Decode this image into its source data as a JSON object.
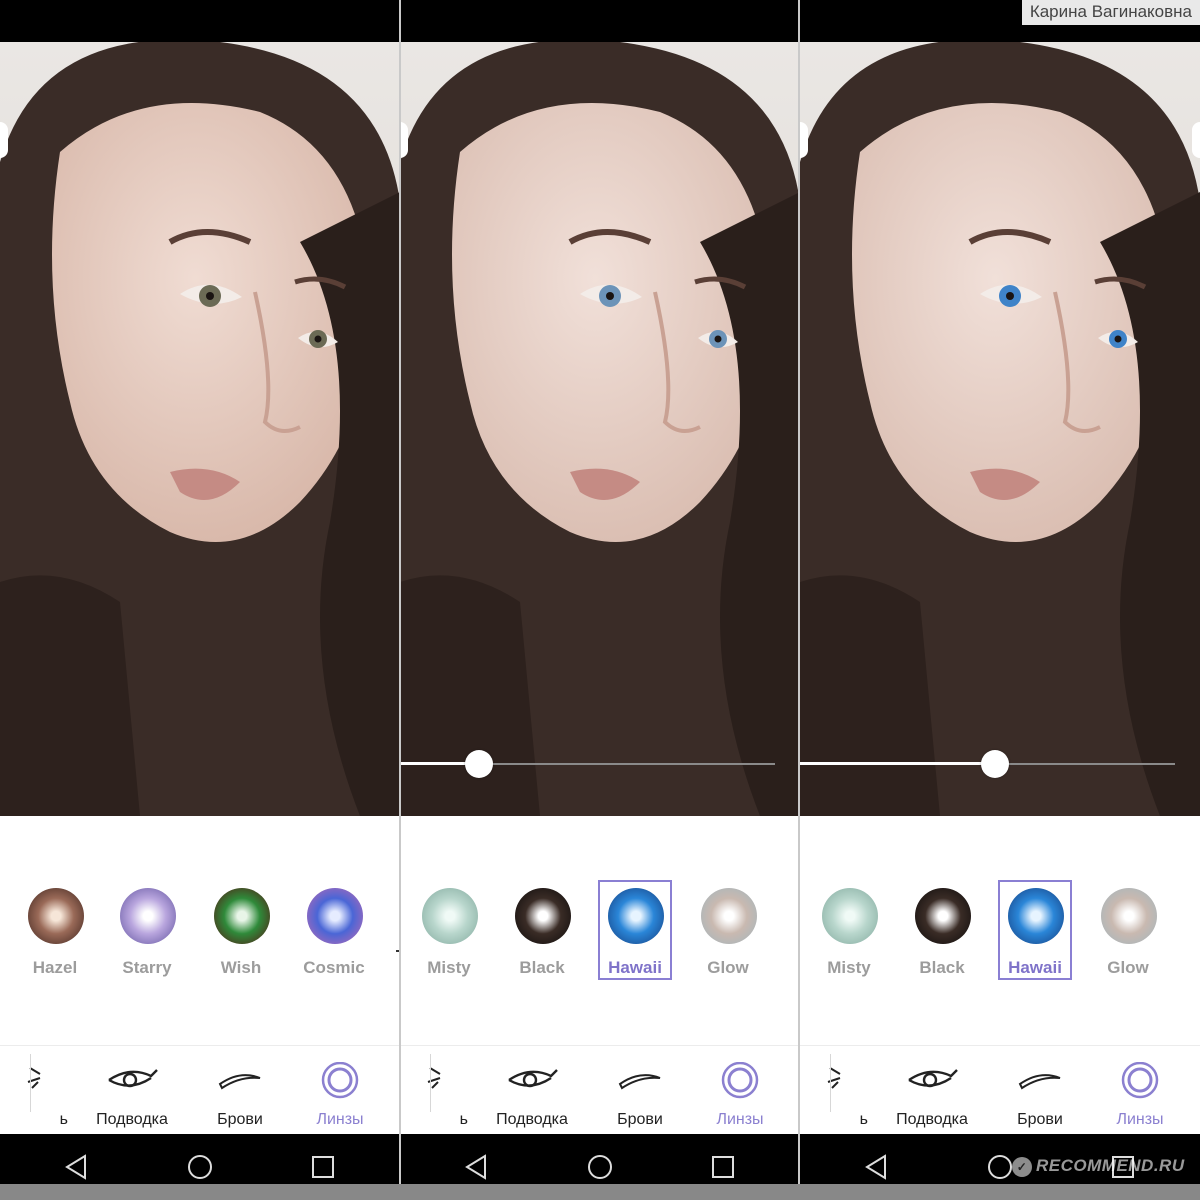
{
  "credit": {
    "author_name": "Карина Вагинаковна",
    "watermark": "RECOMMEND.RU"
  },
  "colors": {
    "accent": "#8b80d0",
    "selected_border": "#8a7fd3",
    "label_gray": "#9c9c9c"
  },
  "panels": [
    {
      "state": "original",
      "slider": null,
      "lenses": [
        {
          "name": "Hazel",
          "selected": false,
          "inner": "#f6e6d8",
          "mid": "#9a6a58",
          "outer": "#3a211b"
        },
        {
          "name": "Starry",
          "selected": false,
          "inner": "#ffffff",
          "mid": "#b9a6de",
          "outer": "#5c4f9c"
        },
        {
          "name": "Wish",
          "selected": false,
          "inner": "#e8f5e8",
          "mid": "#2f8a3a",
          "outer": "#5a0f10"
        },
        {
          "name": "Cosmic",
          "selected": false,
          "inner": "#e6ecff",
          "mid": "#4a66d6",
          "outer": "#c46ab0"
        }
      ],
      "tools": {
        "partial_label": "ь",
        "items": [
          "Подводка",
          "Брови",
          "Линзы"
        ],
        "active_index": 2
      }
    },
    {
      "state": "hawaii-low",
      "slider": {
        "value": 0.21
      },
      "lenses": [
        {
          "name": "Misty",
          "selected": false,
          "inner": "#f0faf6",
          "mid": "#b8d6cc",
          "outer": "#7fa79b"
        },
        {
          "name": "Black",
          "selected": false,
          "inner": "#ffffff",
          "mid": "#3a2c26",
          "outer": "#0c0a0a"
        },
        {
          "name": "Hawaii",
          "selected": true,
          "inner": "#e7f4ff",
          "mid": "#2a86d8",
          "outer": "#153a7a"
        },
        {
          "name": "Glow",
          "selected": false,
          "inner": "#ffffff",
          "mid": "#c9b9b0",
          "outer": "#9fb5bf"
        }
      ],
      "tools": {
        "partial_label": "ь",
        "items": [
          "Подводка",
          "Брови",
          "Линзы"
        ],
        "active_index": 2
      }
    },
    {
      "state": "hawaii-high",
      "slider": {
        "value": 0.52
      },
      "lenses": [
        {
          "name": "Misty",
          "selected": false,
          "inner": "#f0faf6",
          "mid": "#b8d6cc",
          "outer": "#7fa79b"
        },
        {
          "name": "Black",
          "selected": false,
          "inner": "#ffffff",
          "mid": "#3a2c26",
          "outer": "#0c0a0a"
        },
        {
          "name": "Hawaii",
          "selected": true,
          "inner": "#e7f4ff",
          "mid": "#2a86d8",
          "outer": "#153a7a"
        },
        {
          "name": "Glow",
          "selected": false,
          "inner": "#ffffff",
          "mid": "#c9b9b0",
          "outer": "#9fb5bf"
        }
      ],
      "tools": {
        "partial_label": "ь",
        "items": [
          "Подводка",
          "Брови",
          "Линзы"
        ],
        "active_index": 2
      }
    }
  ],
  "eye_colors": {
    "original": "#6b6a55",
    "hawaii-low": "#6c93b8",
    "hawaii-high": "#3f83c8"
  },
  "nav_icons": [
    "back-icon",
    "home-icon",
    "recents-icon"
  ]
}
